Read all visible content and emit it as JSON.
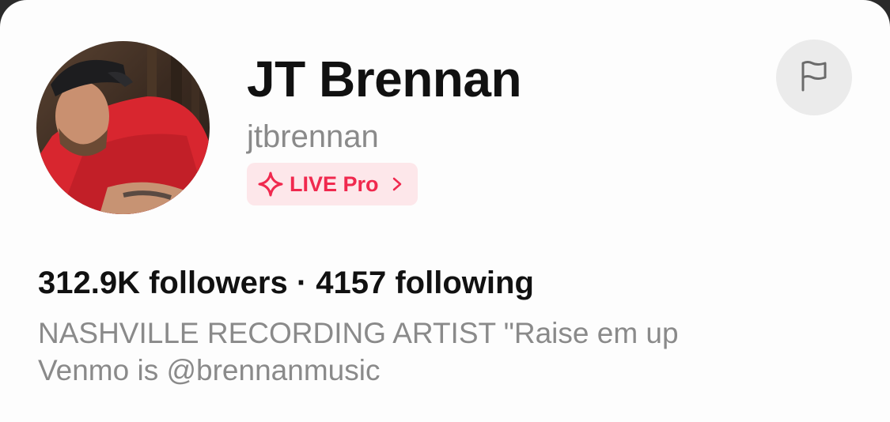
{
  "profile": {
    "display_name": "JT Brennan",
    "username": "jtbrennan",
    "badge": {
      "label": "LIVE Pro",
      "icon": "sparkle-icon",
      "chevron_icon": "chevron-right-icon"
    },
    "report_icon": "flag-icon",
    "avatar_alt": "avatar",
    "stats": {
      "followers": "312.9K followers",
      "separator": "·",
      "following": "4157 following"
    },
    "bio_lines": [
      "NASHVILLE RECORDING ARTIST \"Raise em up",
      "Venmo is @brennanmusic"
    ]
  },
  "colors": {
    "accent": "#f0294e",
    "badge_bg": "#fde7ea",
    "secondary_text": "#8a8a8a",
    "primary_text": "#111111",
    "flag_button_bg": "#ebebeb"
  }
}
